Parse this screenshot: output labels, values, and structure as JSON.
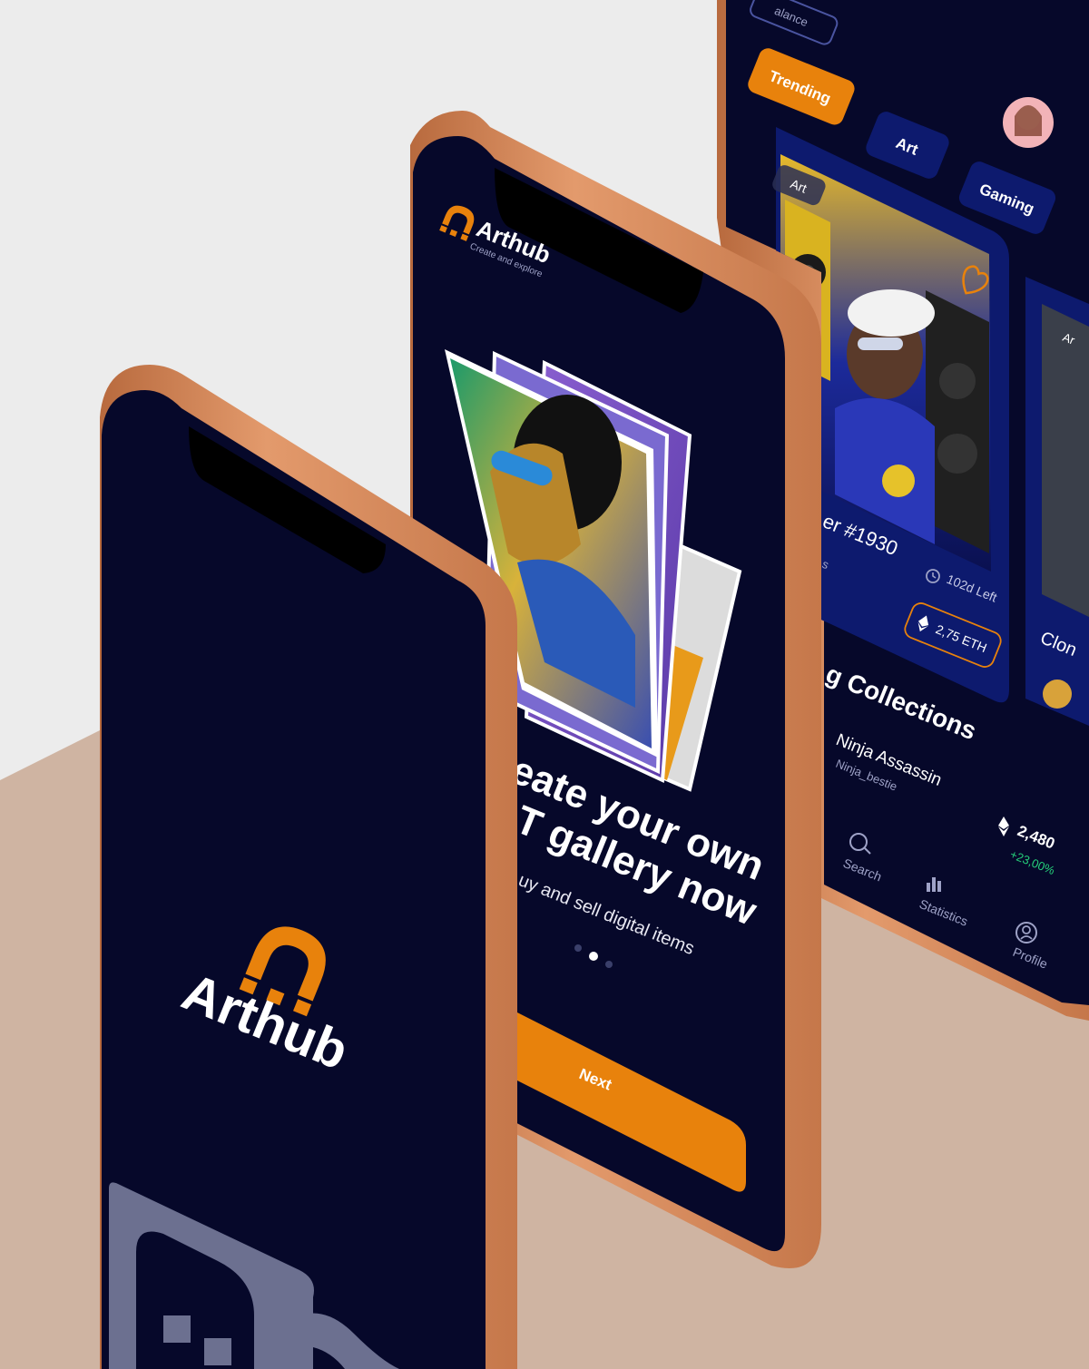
{
  "colors": {
    "background_top": "#ececec",
    "floor": "#cfb4a2",
    "phone_frame": "#d68a5c",
    "screen": "#06082a",
    "card": "#0d1a6e",
    "accent": "#e8820c",
    "text_light": "#ffffff",
    "text_muted": "#9ea2c7",
    "positive": "#25d07a"
  },
  "splash_screen": {
    "brand": "Arthub"
  },
  "onboarding_screen": {
    "brand": "Arthub",
    "tagline": "Create and explore",
    "headline_line1": "eate your own",
    "headline_line2": "T gallery now",
    "subtext": "uy and sell digital items",
    "next_button": "Next"
  },
  "home_screen": {
    "balance_label": "alance",
    "tabs": [
      "Trending",
      "Art",
      "Gaming"
    ],
    "active_tab": "Trending",
    "featured_card": {
      "category": "Art",
      "title": "er #1930",
      "time_left": "102d Left",
      "price": "2,75 ETH",
      "side_text": "s"
    },
    "side_card": {
      "category": "Ar",
      "title": "Clon"
    },
    "section_title": "g Collections",
    "collection": {
      "name": "Ninja Assassin",
      "handle": "Ninja_bestie",
      "value": "2,480",
      "change": "+23,00%"
    },
    "bottom_nav": [
      {
        "label": "Search",
        "icon": "search-icon"
      },
      {
        "label": "Statistics",
        "icon": "statistics-icon"
      },
      {
        "label": "Profile",
        "icon": "profile-icon"
      }
    ]
  }
}
